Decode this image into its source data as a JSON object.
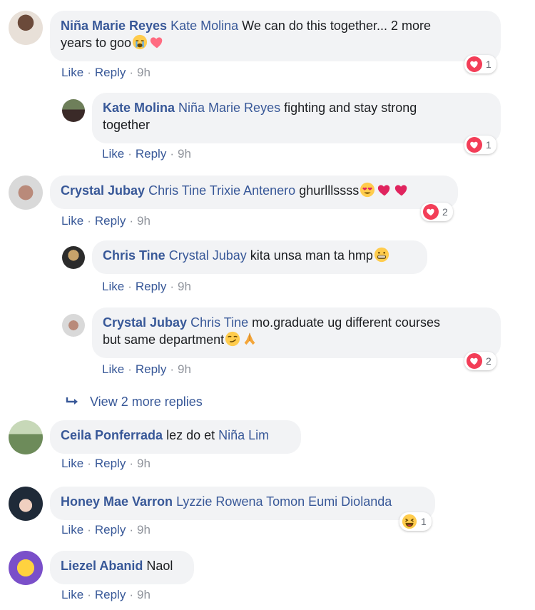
{
  "actions": {
    "like": "Like",
    "reply": "Reply",
    "dot": "·"
  },
  "comments": [
    {
      "author": "Niña Marie Reyes",
      "mention": "Kate Molina",
      "text1": "We can do this together... 2 more",
      "text2": "years to goo",
      "time": "9h",
      "reactions": "1"
    },
    {
      "author": "Kate Molina",
      "mention": "Niña Marie Reyes",
      "text1": "fighting and stay strong",
      "text2": "together",
      "time": "9h",
      "reactions": "1"
    },
    {
      "author": "Crystal Jubay",
      "mention": "Chris Tine Trixie Antenero",
      "text": "ghurlllssss",
      "time": "9h",
      "reactions": "2"
    },
    {
      "author": "Chris Tine",
      "mention": "Crystal Jubay",
      "text": "kita unsa man ta hmp",
      "time": "9h"
    },
    {
      "author": "Crystal Jubay",
      "mention": "Chris Tine",
      "text1": "mo.graduate ug different courses",
      "text2": "but same department",
      "time": "9h",
      "reactions": "2"
    },
    {
      "author": "Ceila Ponferrada",
      "text": "lez do et",
      "mention": "Niña Lim",
      "time": "9h"
    },
    {
      "author": "Honey Mae Varron",
      "mention": "Lyzzie Rowena Tomon Eumi Diolanda",
      "time": "9h",
      "reactions": "1"
    },
    {
      "author": "Liezel Abanid",
      "text": "Naol",
      "time": "9h"
    }
  ],
  "view_more": "View 2 more replies",
  "colors": {
    "link": "#385898",
    "bubble": "#f2f3f5",
    "love": "#f33e58",
    "meta": "#90949c"
  },
  "icons": [
    "reply-arrow-icon",
    "love-reaction-icon",
    "haha-reaction-icon",
    "crying-emoji-icon",
    "heart-emoji-icon",
    "heart-eyes-emoji-icon",
    "grimace-emoji-icon",
    "smirk-emoji-icon",
    "pray-emoji-icon"
  ]
}
